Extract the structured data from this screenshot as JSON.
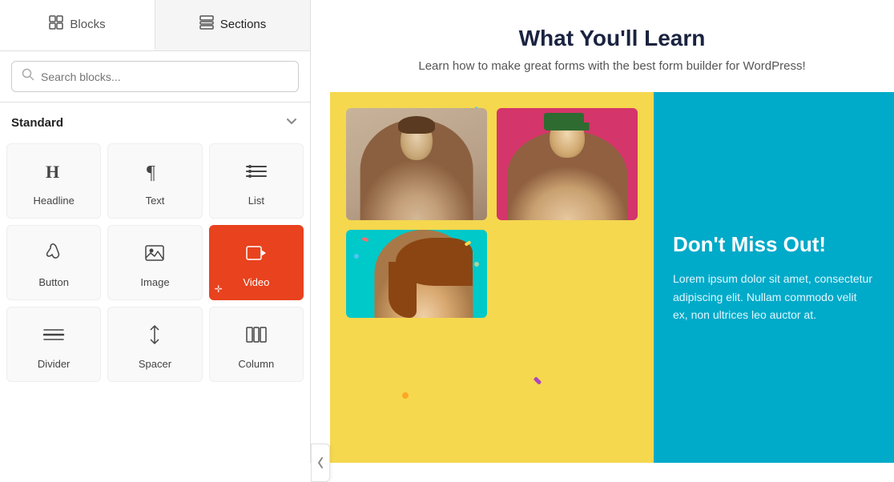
{
  "tabs": [
    {
      "id": "blocks",
      "label": "Blocks",
      "icon": "⊞",
      "active": false
    },
    {
      "id": "sections",
      "label": "Sections",
      "icon": "▤",
      "active": true
    }
  ],
  "search": {
    "placeholder": "Search blocks..."
  },
  "standard_section": {
    "label": "Standard",
    "chevron": "▾"
  },
  "blocks": [
    {
      "id": "headline",
      "label": "Headline",
      "icon": "H"
    },
    {
      "id": "text",
      "label": "Text",
      "icon": "¶"
    },
    {
      "id": "list",
      "label": "List",
      "icon": "≡"
    },
    {
      "id": "button",
      "label": "Button",
      "icon": "☝"
    },
    {
      "id": "image",
      "label": "Image",
      "icon": "⊡"
    },
    {
      "id": "video",
      "label": "Video",
      "icon": "▶",
      "active": true
    },
    {
      "id": "divider",
      "label": "Divider",
      "icon": "—"
    },
    {
      "id": "spacer",
      "label": "Spacer",
      "icon": "↕"
    },
    {
      "id": "column",
      "label": "Column",
      "icon": "⦿"
    }
  ],
  "content": {
    "heading": "What You'll Learn",
    "subheading": "Learn how to make great forms with the best form builder for WordPress!",
    "promo_heading": "Don't Miss Out!",
    "promo_body": "Lorem ipsum dolor sit amet, consectetur adipiscing elit. Nullam commodo velit ex, non ultrices leo auctor at."
  },
  "colors": {
    "video_active": "#e8421e",
    "yellow_bg": "#f5d84e",
    "teal_bg": "#00aac9",
    "pink_photo": "#e85d8a",
    "cyan_photo": "#00c9c9",
    "heading_dark": "#1a2340"
  }
}
